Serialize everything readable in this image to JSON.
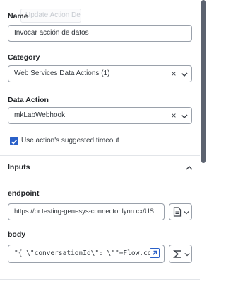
{
  "tooltip_ghost": "Update Action Details",
  "name": {
    "label": "Name",
    "value": "Invocar acción de datos"
  },
  "category": {
    "label": "Category",
    "value": "Web Services Data Actions (1)"
  },
  "data_action": {
    "label": "Data Action",
    "value": "mkLabWebhook"
  },
  "timeout": {
    "label": "Use action's suggested timeout",
    "checked": true
  },
  "inputs": {
    "title": "Inputs",
    "endpoint": {
      "label": "endpoint",
      "value": "https://br.testing-genesys-connector.lynn.cx/US..."
    },
    "body": {
      "label": "body",
      "value": "\"{ \\\"conversationId\\\": \\\"\"+Flow.conve"
    }
  },
  "colors": {
    "accent": "#2a60c8",
    "border": "#9aa1ab",
    "divider": "#e2e5e9",
    "scrollbar": "#5c6370"
  },
  "icons": {
    "clear": "close-icon",
    "dropdown": "chevron-down-icon",
    "collapse": "chevron-up-icon",
    "checkbox": "checkmark-icon",
    "document": "document-icon",
    "expand": "expand-arrow-icon",
    "expression": "sigma-icon"
  }
}
